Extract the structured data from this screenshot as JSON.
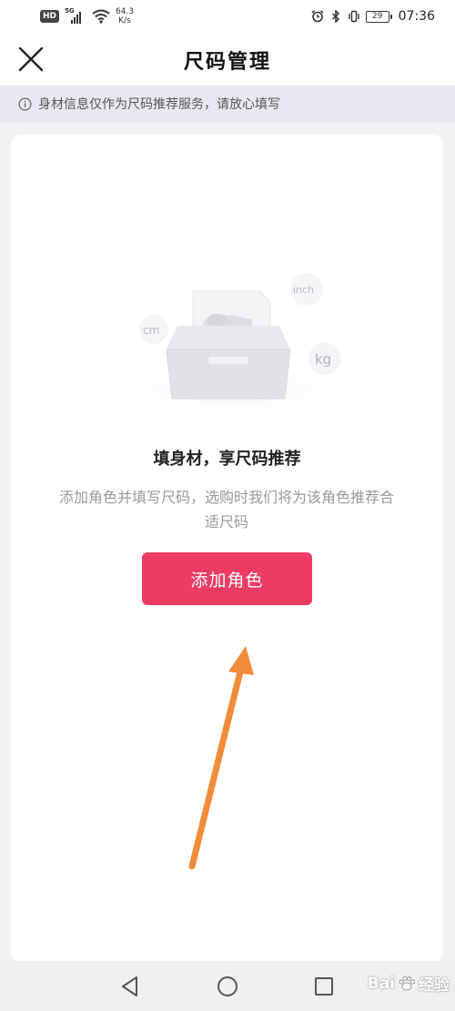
{
  "status_bar": {
    "hd": "HD",
    "network": "5G",
    "speed_value": "64.3",
    "speed_unit": "K/s",
    "battery": "29",
    "time": "07:36"
  },
  "header": {
    "title": "尺码管理",
    "close_icon": "close-icon"
  },
  "notice": {
    "icon": "info-icon",
    "text": "身材信息仅作为尺码推荐服务，请放心填写"
  },
  "empty_state": {
    "illustration_labels": {
      "cm": "cm",
      "inch": "inch",
      "kg": "kg"
    },
    "title": "填身材，享尺码推荐",
    "description": "添加角色并填写尺码，选购时我们将为该角色推荐合适尺码",
    "add_button_label": "添加角色"
  },
  "annotation": {
    "arrow_color": "#f28c3a"
  },
  "nav_bar": {
    "back_icon": "back-triangle-icon",
    "home_icon": "home-circle-icon",
    "recent_icon": "recent-square-icon"
  },
  "watermark": {
    "text_a": "Bai",
    "text_b": "经验"
  },
  "colors": {
    "accent": "#ee3b64",
    "notice_bg": "#e8e9f0",
    "page_bg": "#f2f2f4"
  }
}
